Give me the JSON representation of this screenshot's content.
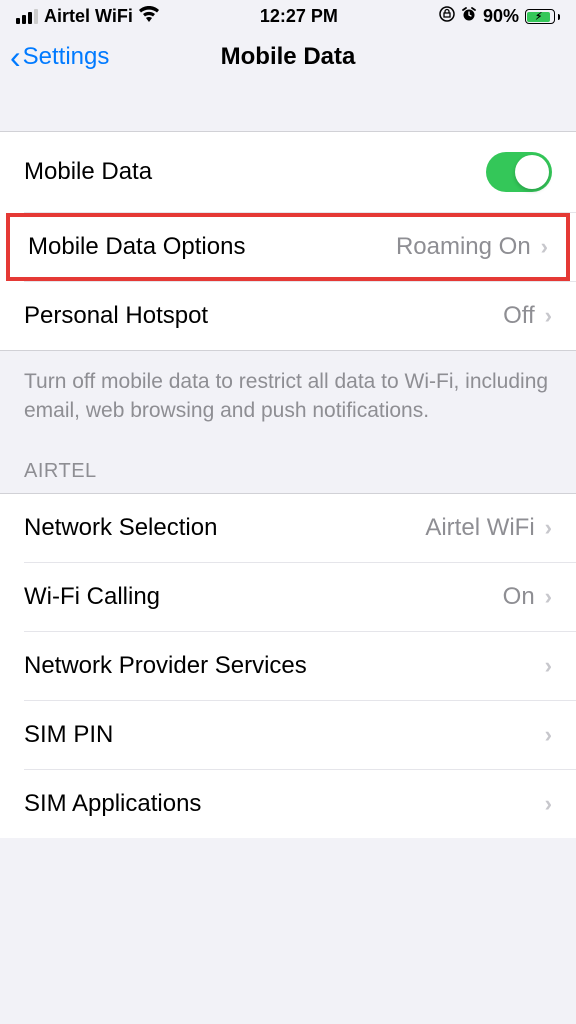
{
  "status": {
    "carrier": "Airtel WiFi",
    "time": "12:27 PM",
    "battery_pct": "90%"
  },
  "nav": {
    "back_label": "Settings",
    "title": "Mobile Data"
  },
  "group1": {
    "mobile_data": {
      "label": "Mobile Data"
    },
    "mobile_data_options": {
      "label": "Mobile Data Options",
      "value": "Roaming On"
    },
    "personal_hotspot": {
      "label": "Personal Hotspot",
      "value": "Off"
    },
    "footer": "Turn off mobile data to restrict all data to Wi-Fi, including email, web browsing and push notifications."
  },
  "carrier_section": {
    "header": "AIRTEL",
    "network_selection": {
      "label": "Network Selection",
      "value": "Airtel WiFi"
    },
    "wifi_calling": {
      "label": "Wi-Fi Calling",
      "value": "On"
    },
    "provider_services": {
      "label": "Network Provider Services"
    },
    "sim_pin": {
      "label": "SIM PIN"
    },
    "sim_applications": {
      "label": "SIM Applications"
    }
  }
}
